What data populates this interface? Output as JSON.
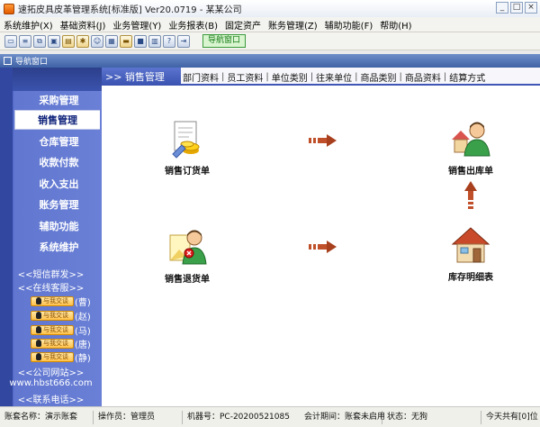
{
  "window": {
    "title": "速拓皮具皮革管理系统[标准版] Ver20.0719 - 某某公司",
    "buttons": {
      "minimize": "_",
      "maximize": "□",
      "close": "×"
    }
  },
  "menu": [
    "系统维护(X)",
    "基础资料(J)",
    "业务管理(Y)",
    "业务报表(B)",
    "固定资产",
    "账务管理(Z)",
    "辅助功能(F)",
    "帮助(H)"
  ],
  "toolbar": {
    "nav_button": "导航窗口"
  },
  "nav_tab": {
    "label": "导航窗口"
  },
  "sidebar": {
    "items": [
      "采购管理",
      "销售管理",
      "仓库管理",
      "收款付款",
      "收入支出",
      "账务管理",
      "辅助功能",
      "系统维护"
    ],
    "active_index": 1,
    "sms": "<<短信群发>>",
    "online_service": "<<在线客服>>",
    "qq_badge": "与我交谈",
    "qq_contacts": [
      "(曹)",
      "(赵)",
      "(马)",
      "(唐)",
      "(静)"
    ],
    "website_label": "<<公司网站>>",
    "website_url": "www.hbst666.com",
    "phone_label": "<<联系电话>>"
  },
  "content": {
    "title": ">> 销售管理",
    "links": [
      "部门资料",
      "员工资料",
      "单位类别",
      "往来单位",
      "商品类别",
      "商品资料",
      "结算方式"
    ],
    "modules": {
      "sales_order": "销售订货单",
      "sales_out": "销售出库单",
      "sales_return": "销售退货单",
      "inventory_detail": "库存明细表"
    }
  },
  "status": {
    "account": "账套名称：演示账套",
    "operator": "操作员：管理员",
    "machine": "机器号：PC-20200521085",
    "period": "会计期间：账套未启用",
    "state": "状态：无狗",
    "messages": "今天共有[0]位"
  },
  "colors": {
    "sidebar": "#5069c8",
    "accent": "#3f56b6",
    "arrow": "#c0502a"
  }
}
